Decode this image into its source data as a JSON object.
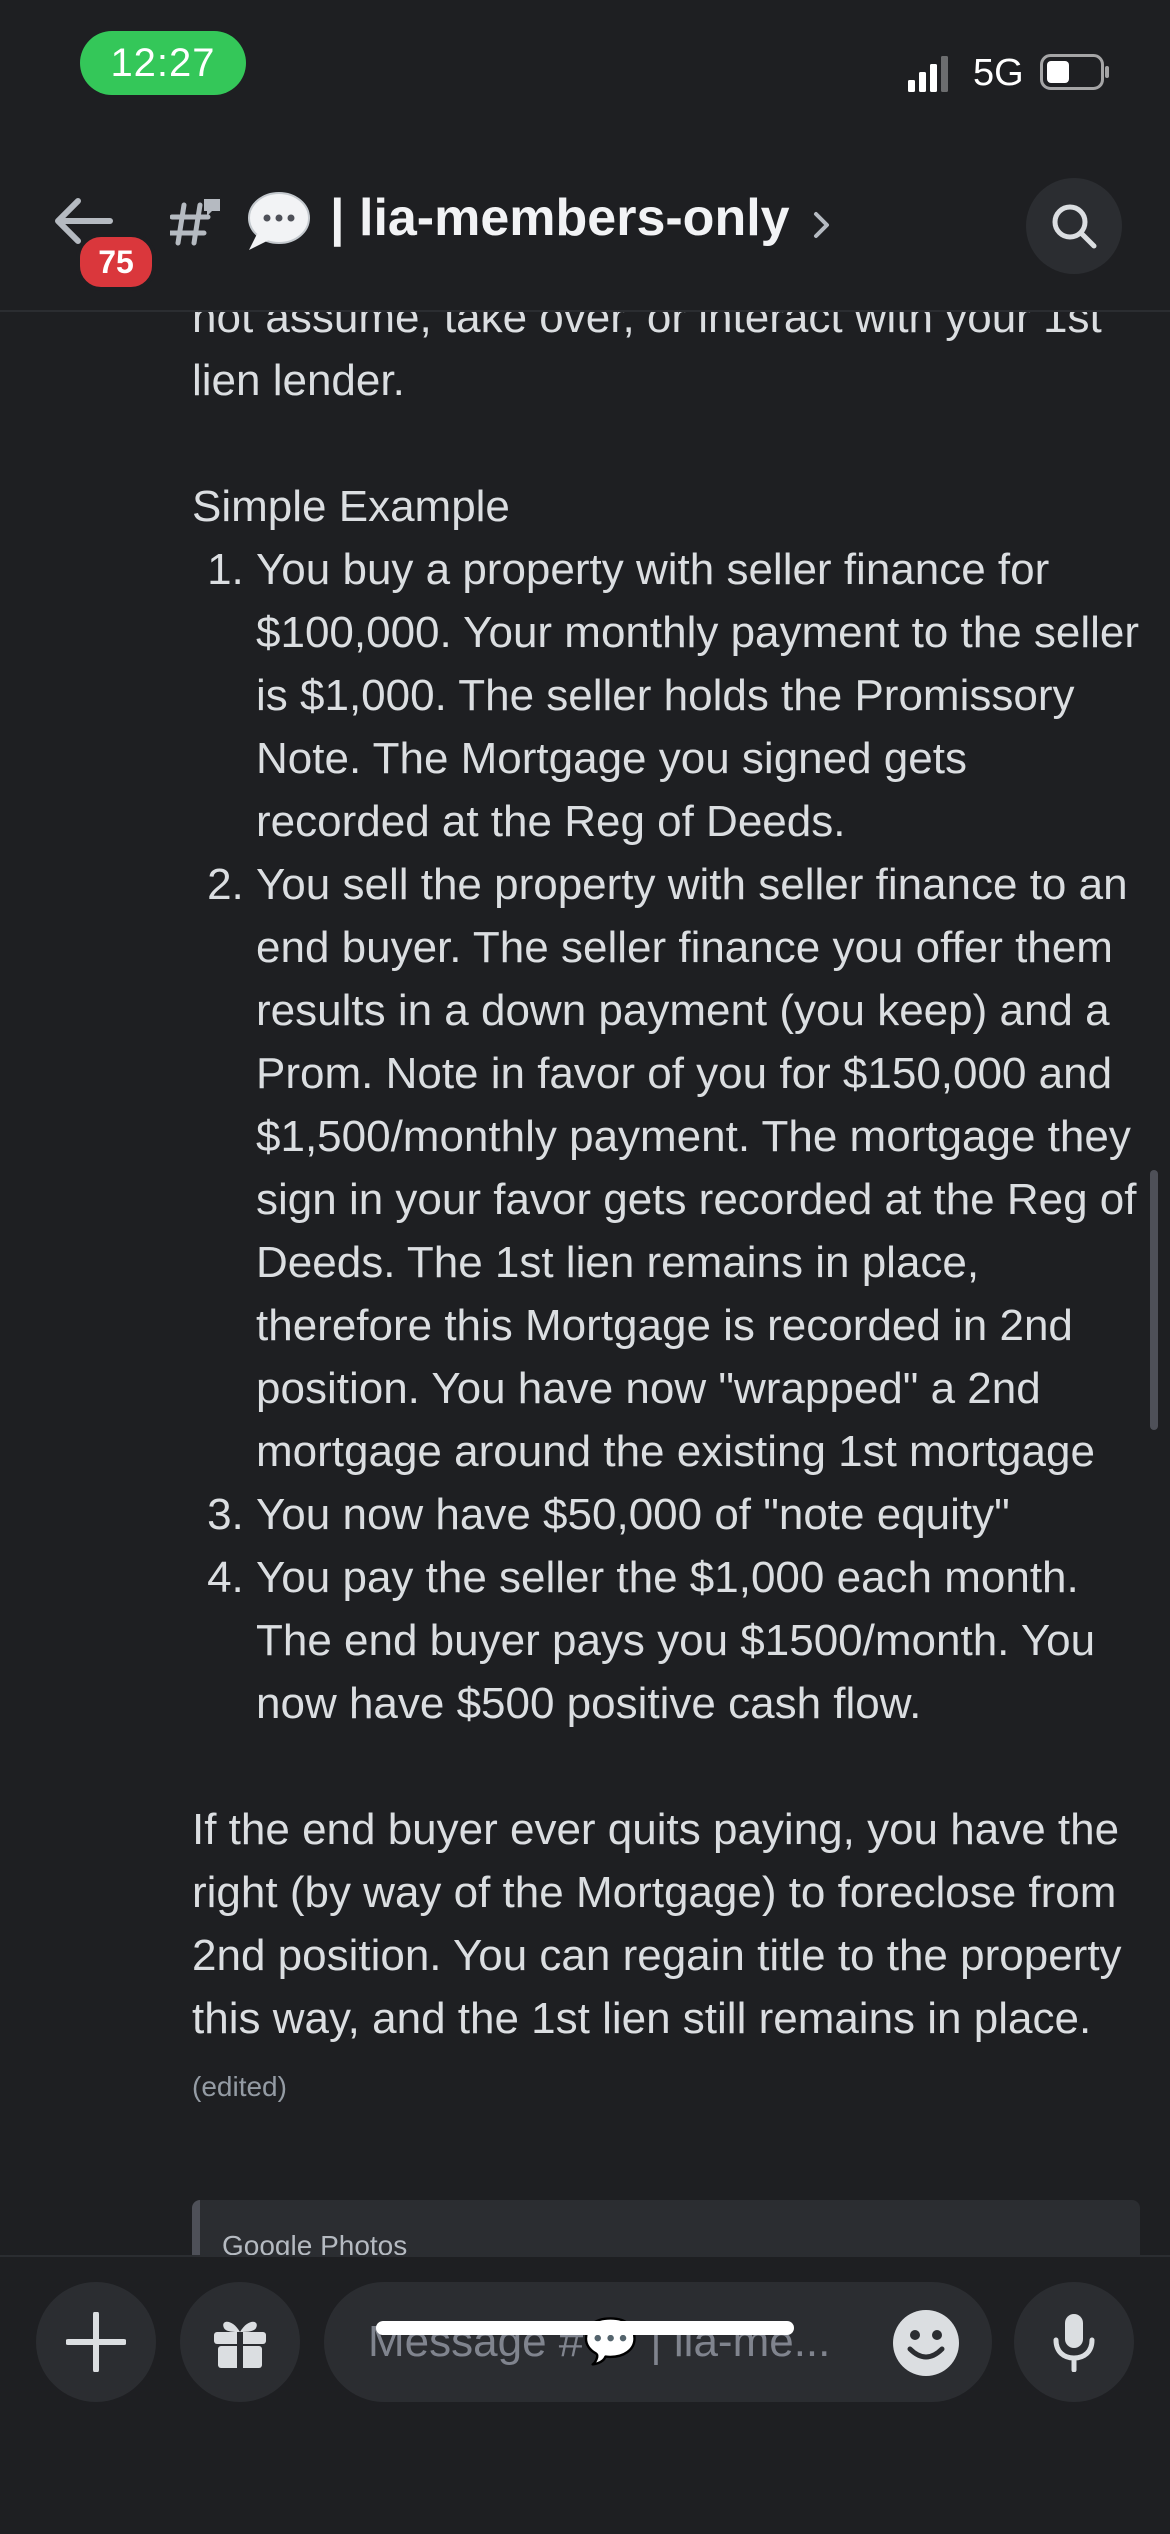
{
  "status_bar": {
    "time": "12:27",
    "network": "5G",
    "accent_color": "#34c759"
  },
  "header": {
    "channel_name": "| lia-members-only",
    "unread_count": "75",
    "icons": [
      "back-arrow-icon",
      "thread-icon",
      "speech-bubble-icon",
      "chevron-right-icon",
      "search-icon"
    ],
    "badge_color": "#da373c"
  },
  "message": {
    "lead_in": "not assume, take over, or interact with your 1st lien lender.",
    "example_title": "Simple Example",
    "steps": [
      "You buy a property with seller finance for $100,000.  Your monthly payment to the seller is $1,000.  The seller holds the Promissory Note.  The Mortgage you signed gets recorded at the Reg of Deeds.",
      "You sell the property with seller finance to an end buyer.  The seller finance you offer them results in a down payment (you keep) and a Prom. Note in favor of you for $150,000 and $1,500/monthly payment. The mortgage they sign in your favor gets recorded at the Reg of Deeds.  The 1st lien remains in place, therefore this Mortgage is recorded in 2nd position. You have now \"wrapped\" a 2nd  mortgage around the existing 1st mortgage",
      "You now have $50,000 of \"note equity\"",
      "You pay the seller the $1,000 each month.  The end buyer pays you $1500/month.  You now have $500 positive cash flow."
    ],
    "closing": "If the end buyer ever quits paying, you have the right (by way of the Mortgage) to foreclose from 2nd position.  You can regain title to the property this way, and the 1st lien still remains in place.",
    "edited_label": "(edited)"
  },
  "embed": {
    "provider": "Google Photos"
  },
  "composer": {
    "placeholder": "Message #💬 | lia-me...",
    "icons": [
      "plus-icon",
      "gift-icon",
      "emoji-icon",
      "microphone-icon"
    ]
  }
}
